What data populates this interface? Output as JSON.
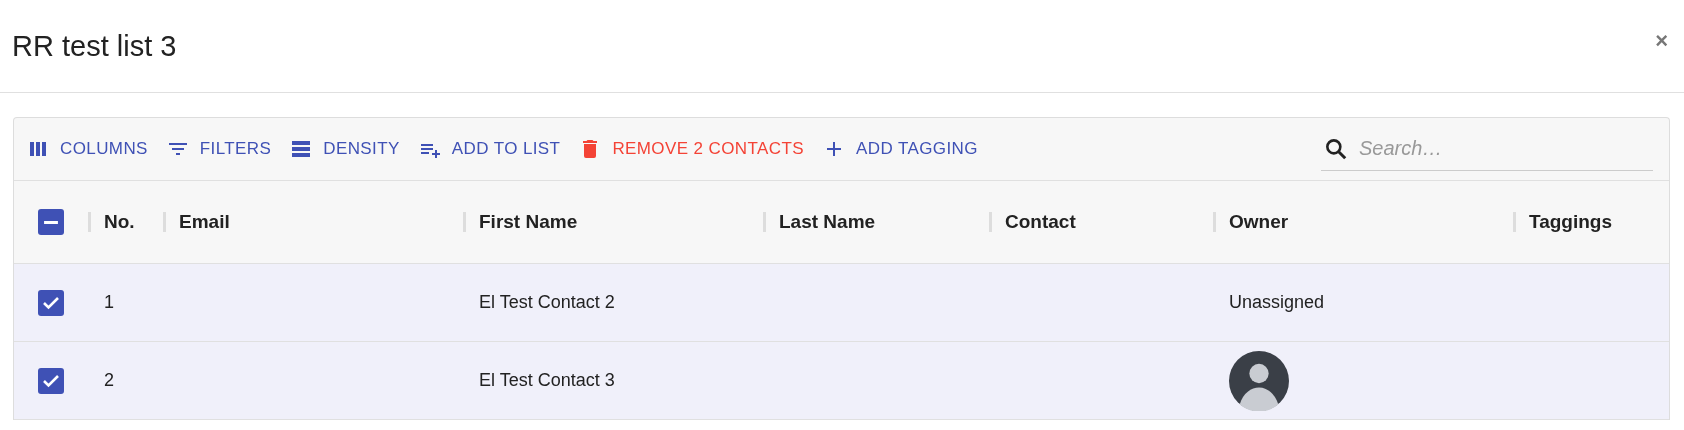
{
  "dialog": {
    "title": "RR test list 3",
    "close": "×"
  },
  "toolbar": {
    "actions": [
      {
        "label": "COLUMNS",
        "color": "#3f51b5"
      },
      {
        "label": "FILTERS",
        "color": "#3f51b5"
      },
      {
        "label": "DENSITY",
        "color": "#3f51b5"
      },
      {
        "label": "ADD TO LIST",
        "color": "#3f51b5"
      },
      {
        "label": "REMOVE 2 CONTACTS",
        "color": "#f44336"
      },
      {
        "label": "ADD TAGGING",
        "color": "#3f51b5"
      }
    ],
    "search": {
      "placeholder": "Search…"
    }
  },
  "table": {
    "select_all": {
      "indeterminate": true
    },
    "columns": [
      "No.",
      "Email",
      "First Name",
      "Last Name",
      "Contact",
      "Owner",
      "Taggings"
    ],
    "rows": [
      {
        "selected": true,
        "cells": [
          "1",
          "",
          "El Test Contact 2",
          "",
          "",
          {
            "kind": "text",
            "text": "Unassigned"
          },
          ""
        ]
      },
      {
        "selected": true,
        "cells": [
          "2",
          "",
          "El Test Contact 3",
          "",
          "",
          {
            "kind": "avatar"
          },
          ""
        ]
      }
    ]
  }
}
